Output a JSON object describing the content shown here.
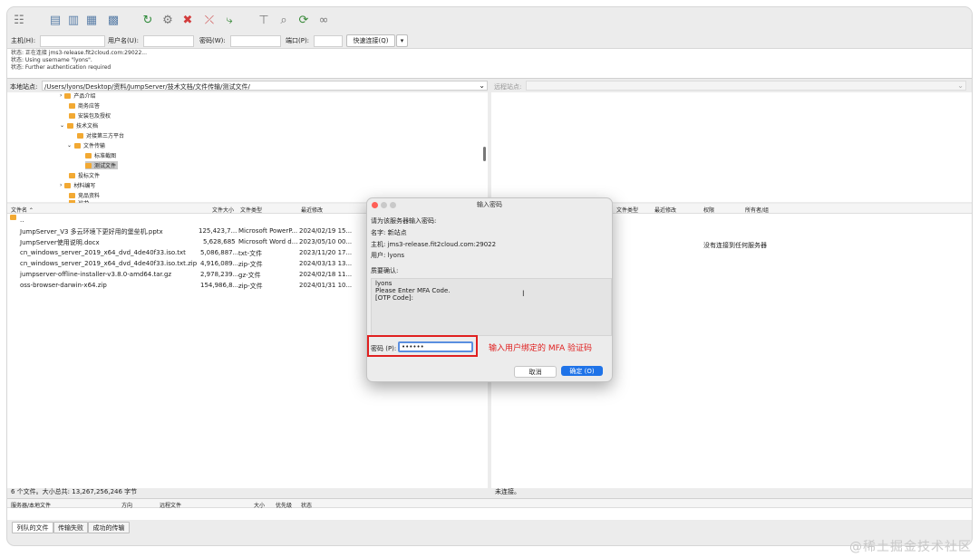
{
  "quickconnect": {
    "host_label": "主机(H):",
    "user_label": "用户名(U):",
    "pass_label": "密码(W):",
    "port_label": "端口(P):",
    "connect_label": "快速连接(Q)",
    "dropdown_glyph": "▾"
  },
  "log": [
    "状态: 正在连接 jms3-release.fit2cloud.com:29022...",
    "状态: Using username \"lyons\".",
    "状态: Further authentication required"
  ],
  "local": {
    "site_label": "本地站点:",
    "site_path": "/Users/lyons/Desktop/资料/JumpServer/技术文档/文件传输/测试文件/",
    "tree": [
      {
        "label": "产品介绍",
        "arrow": "›"
      },
      {
        "label": "商务应答",
        "arrow": ""
      },
      {
        "label": "安装包及授权",
        "arrow": ""
      },
      {
        "label": "技术文档",
        "arrow": "⌄"
      },
      {
        "label": "对接第三方平台",
        "arrow": ""
      },
      {
        "label": "文件传输",
        "arrow": "⌄"
      },
      {
        "label": "标准截图",
        "arrow": ""
      },
      {
        "label": "测试文件",
        "arrow": ""
      },
      {
        "label": "投标文件",
        "arrow": ""
      },
      {
        "label": "材料编写",
        "arrow": "›"
      },
      {
        "label": "竞品资料",
        "arrow": ""
      },
      {
        "label": "证书",
        "arrow": ""
      }
    ],
    "columns": [
      "文件名 ⌃",
      "文件大小",
      "文件类型",
      "最近修改"
    ],
    "parent_dir": "..",
    "files": [
      {
        "name": "JumpServer_V3 多云环境下更好用的堡垒机.pptx",
        "size": "125,423,7...",
        "type": "Microsoft PowerP...",
        "modified": "2024/02/19 15..."
      },
      {
        "name": "JumpServer使用说明.docx",
        "size": "5,628,685",
        "type": "Microsoft Word d...",
        "modified": "2023/05/10 00..."
      },
      {
        "name": "cn_windows_server_2019_x64_dvd_4de40f33.iso.txt",
        "size": "5,086,887...",
        "type": "txt-文件",
        "modified": "2023/11/20 17..."
      },
      {
        "name": "cn_windows_server_2019_x64_dvd_4de40f33.iso.txt.zip",
        "size": "4,916,089...",
        "type": "zip-文件",
        "modified": "2024/03/13 13..."
      },
      {
        "name": "jumpserver-offline-installer-v3.8.0-amd64.tar.gz",
        "size": "2,978,239...",
        "type": "gz-文件",
        "modified": "2024/02/18 11..."
      },
      {
        "name": "oss-browser-darwin-x64.zip",
        "size": "154,986,8...",
        "type": "zip-文件",
        "modified": "2024/01/31 10..."
      }
    ],
    "summary": "6 个文件。大小总共: 13,267,256,246 字节"
  },
  "remote": {
    "site_label": "远程站点:",
    "columns": [
      "文件类型",
      "最近修改",
      "权限",
      "所有者/组"
    ],
    "empty_text": "没有连接到任何服务器",
    "status": "未连接。"
  },
  "queue": {
    "columns": [
      "服务器/本地文件",
      "方向",
      "远程文件",
      "大小",
      "优先级",
      "状态"
    ],
    "tabs": [
      "列队的文件",
      "传输失败",
      "成功的传输"
    ]
  },
  "dialog": {
    "title": "输入密码",
    "prompt": "请为该服务器输入密码:",
    "name_line": "名字:  新站点",
    "host_line": "主机:  jms3-release.fit2cloud.com:29022",
    "user_line": "用户:  lyons",
    "challenge_label": "质要确认:",
    "challenge_lines": [
      "lyons",
      "Please Enter MFA Code.",
      "[OTP Code]:"
    ],
    "password_label": "密码 (P):",
    "password_value": "••••••",
    "cancel_label": "取消",
    "ok_label": "确定 (O)",
    "cursor_glyph": "I"
  },
  "annotation": {
    "text": "输入用户绑定的 MFA 验证码",
    "color": "#e02020"
  },
  "watermark": "@稀土掘金技术社区",
  "colors": {
    "accent": "#1f73e8",
    "folder": "#f2a933",
    "close_light": "#ff5f57"
  }
}
